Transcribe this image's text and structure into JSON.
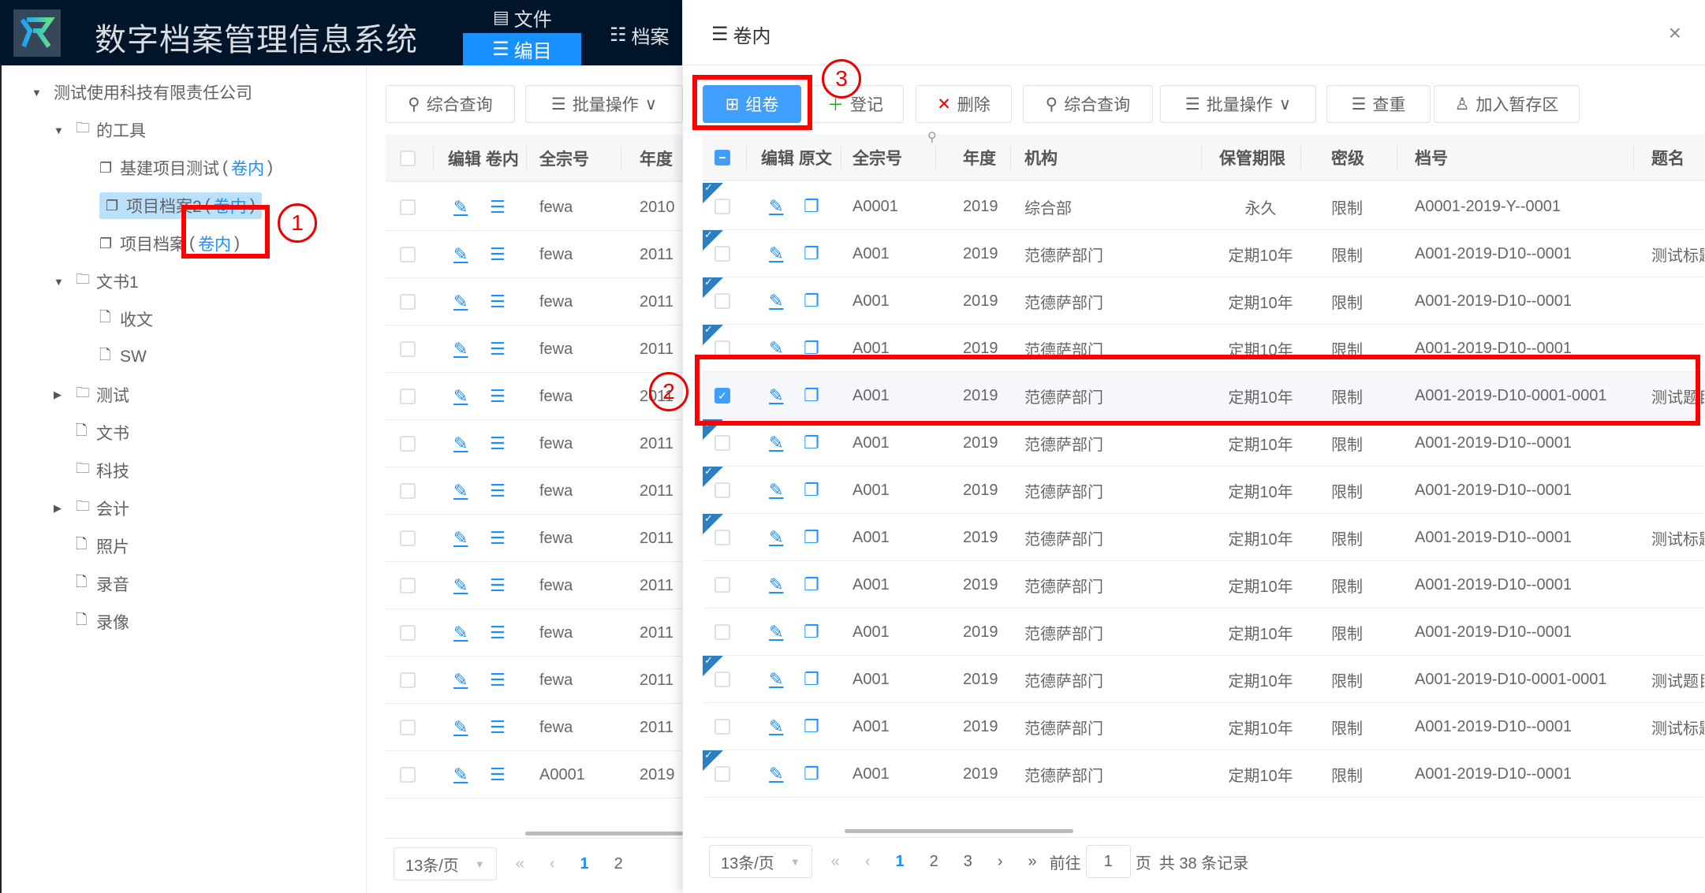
{
  "header": {
    "title": "数字档案管理信息系统",
    "nav": [
      {
        "label": "文件",
        "icon": "file-icon"
      },
      {
        "label": "编目",
        "icon": "ordered-list-icon",
        "active": true
      },
      {
        "label": "档案",
        "icon": "database-icon"
      }
    ]
  },
  "tree": {
    "root": "测试使用科技有限责任公司",
    "nodes": [
      {
        "label": "的工具",
        "type": "folder",
        "expanded": true
      },
      {
        "label": "基建项目测试",
        "type": "volume",
        "suffix": "卷内"
      },
      {
        "label": "项目档案2",
        "type": "volume",
        "suffix": "卷内",
        "selected": true
      },
      {
        "label": "项目档案",
        "type": "volume",
        "suffix": "卷内"
      },
      {
        "label": "文书1",
        "type": "folder",
        "expanded": true
      },
      {
        "label": "收文",
        "type": "file"
      },
      {
        "label": "SW",
        "type": "file"
      },
      {
        "label": "测试",
        "type": "folder",
        "expanded": false
      },
      {
        "label": "文书",
        "type": "file"
      },
      {
        "label": "科技",
        "type": "folder"
      },
      {
        "label": "会计",
        "type": "folder",
        "expanded": false
      },
      {
        "label": "照片",
        "type": "file"
      },
      {
        "label": "录音",
        "type": "file"
      },
      {
        "label": "录像",
        "type": "file"
      }
    ],
    "paren_open": "(",
    "paren_close": ")"
  },
  "middle": {
    "toolbar": {
      "search": "综合查询",
      "batch": "批量操作"
    },
    "columns": [
      "编辑 卷内",
      "全宗号",
      "年度"
    ],
    "rows": [
      {
        "fonds": "fewa",
        "year": "2010"
      },
      {
        "fonds": "fewa",
        "year": "2011"
      },
      {
        "fonds": "fewa",
        "year": "2011"
      },
      {
        "fonds": "fewa",
        "year": "2011"
      },
      {
        "fonds": "fewa",
        "year": "2011"
      },
      {
        "fonds": "fewa",
        "year": "2011"
      },
      {
        "fonds": "fewa",
        "year": "2011"
      },
      {
        "fonds": "fewa",
        "year": "2011"
      },
      {
        "fonds": "fewa",
        "year": "2011"
      },
      {
        "fonds": "fewa",
        "year": "2011"
      },
      {
        "fonds": "fewa",
        "year": "2011"
      },
      {
        "fonds": "fewa",
        "year": "2011"
      },
      {
        "fonds": "A0001",
        "year": "2019"
      }
    ],
    "pagination": {
      "page_size": "13条/页",
      "pages": [
        "1",
        "2"
      ],
      "current": "1"
    }
  },
  "drawer": {
    "title": "卷内",
    "close": "×",
    "toolbar": {
      "group": "组卷",
      "register": "登记",
      "delete": "删除",
      "search": "综合查询",
      "batch": "批量操作",
      "dedupe": "查重",
      "staging": "加入暂存区"
    },
    "columns": [
      "编辑 原文",
      "全宗号",
      "年度",
      "机构",
      "保管期限",
      "密级",
      "档号",
      "题名"
    ],
    "rows": [
      {
        "fonds": "A0001",
        "year": "2019",
        "org": "综合部",
        "retention": "永久",
        "secret": "限制",
        "code": "A0001-2019-Y--0001",
        "title": "",
        "marked": true,
        "checked": false
      },
      {
        "fonds": "A001",
        "year": "2019",
        "org": "范德萨部门",
        "retention": "定期10年",
        "secret": "限制",
        "code": "A001-2019-D10--0001",
        "title": "测试标题",
        "marked": true,
        "checked": false
      },
      {
        "fonds": "A001",
        "year": "2019",
        "org": "范德萨部门",
        "retention": "定期10年",
        "secret": "限制",
        "code": "A001-2019-D10--0001",
        "title": "",
        "marked": true,
        "checked": false
      },
      {
        "fonds": "A001",
        "year": "2019",
        "org": "范德萨部门",
        "retention": "定期10年",
        "secret": "限制",
        "code": "A001-2019-D10--0001",
        "title": "",
        "marked": true,
        "checked": false
      },
      {
        "fonds": "A001",
        "year": "2019",
        "org": "范德萨部门",
        "retention": "定期10年",
        "secret": "限制",
        "code": "A001-2019-D10-0001-0001",
        "title": "测试题目",
        "marked": false,
        "checked": true
      },
      {
        "fonds": "A001",
        "year": "2019",
        "org": "范德萨部门",
        "retention": "定期10年",
        "secret": "限制",
        "code": "A001-2019-D10--0001",
        "title": "",
        "marked": true,
        "checked": false
      },
      {
        "fonds": "A001",
        "year": "2019",
        "org": "范德萨部门",
        "retention": "定期10年",
        "secret": "限制",
        "code": "A001-2019-D10--0001",
        "title": "",
        "marked": true,
        "checked": false
      },
      {
        "fonds": "A001",
        "year": "2019",
        "org": "范德萨部门",
        "retention": "定期10年",
        "secret": "限制",
        "code": "A001-2019-D10--0001",
        "title": "测试标题",
        "marked": true,
        "checked": false
      },
      {
        "fonds": "A001",
        "year": "2019",
        "org": "范德萨部门",
        "retention": "定期10年",
        "secret": "限制",
        "code": "A001-2019-D10--0001",
        "title": "",
        "marked": false,
        "checked": false
      },
      {
        "fonds": "A001",
        "year": "2019",
        "org": "范德萨部门",
        "retention": "定期10年",
        "secret": "限制",
        "code": "A001-2019-D10--0001",
        "title": "",
        "marked": false,
        "checked": false
      },
      {
        "fonds": "A001",
        "year": "2019",
        "org": "范德萨部门",
        "retention": "定期10年",
        "secret": "限制",
        "code": "A001-2019-D10-0001-0001",
        "title": "测试题目",
        "marked": true,
        "checked": false
      },
      {
        "fonds": "A001",
        "year": "2019",
        "org": "范德萨部门",
        "retention": "定期10年",
        "secret": "限制",
        "code": "A001-2019-D10--0001",
        "title": "测试标题",
        "marked": false,
        "checked": false
      },
      {
        "fonds": "A001",
        "year": "2019",
        "org": "范德萨部门",
        "retention": "定期10年",
        "secret": "限制",
        "code": "A001-2019-D10--0001",
        "title": "",
        "marked": true,
        "checked": false
      }
    ],
    "pagination": {
      "page_size": "13条/页",
      "pages": [
        "1",
        "2",
        "3"
      ],
      "current": "1",
      "goto_label": "前往",
      "goto_value": "1",
      "page_unit": "页",
      "total": "共 38 条记录"
    }
  },
  "annotations": [
    "1",
    "2",
    "3"
  ],
  "colors": {
    "accent": "#1890ff",
    "primary_button": "#409eff",
    "header_bg": "#00142a",
    "annotation": "#ff0000"
  }
}
